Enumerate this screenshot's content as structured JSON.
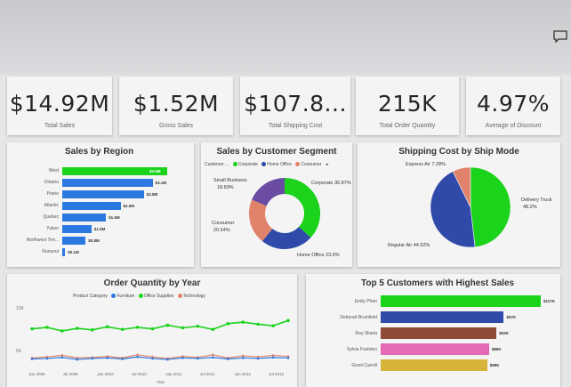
{
  "kpis": [
    {
      "value": "$14.92M",
      "label": "Total Sales"
    },
    {
      "value": "$1.52M",
      "label": "Gross Sales"
    },
    {
      "value": "$107.8...",
      "label": "Total Shipping Cost"
    },
    {
      "value": "215K",
      "label": "Total Order Quantity"
    },
    {
      "value": "4.97%",
      "label": "Average of Discount"
    }
  ],
  "colors": {
    "green": "#1ad31a",
    "blue": "#2a78e0",
    "navy": "#2f4aa8",
    "purple": "#6a4da3",
    "salmon": "#e0836a",
    "brown": "#8e4a34",
    "pink": "#e46ab6",
    "gold": "#d8b33a"
  },
  "sales_region": {
    "title": "Sales by Region",
    "chart_data": {
      "type": "bar",
      "categories": [
        "West",
        "Ontario",
        "Prarie",
        "Atlantic",
        "Quebec",
        "Yukon",
        "Northwest Terr...",
        "Nunavut"
      ],
      "values": [
        3.6,
        3.1,
        2.8,
        2.0,
        1.5,
        1.0,
        0.8,
        0.1
      ],
      "value_labels": [
        "$3.6M",
        "$3.1M",
        "$2.8M",
        "$2.0M",
        "$1.5M",
        "$1.0M",
        "$0.8M",
        "$0.1M"
      ]
    }
  },
  "segment": {
    "title": "Sales by Customer Segment",
    "legend_prefix": "Customer ...",
    "legend": [
      "Corporate",
      "Home Office",
      "Consumer"
    ],
    "chart_data": {
      "type": "pie",
      "categories": [
        "Corporate",
        "Home Office",
        "Consumer",
        "Small Business"
      ],
      "values": [
        36.87,
        23.9,
        20.54,
        18.69
      ]
    },
    "labels": {
      "corporate": "Corporate 36.87%",
      "home_office": "Home Office 23.9%",
      "consumer_name": "Consumer",
      "consumer_pct": "20.54%",
      "small_business_name": "Small Business",
      "small_business_pct": "18.69%"
    }
  },
  "ship_mode": {
    "title": "Shipping Cost by Ship Mode",
    "chart_data": {
      "type": "pie",
      "categories": [
        "Delivery Truck",
        "Regular Air",
        "Express Air"
      ],
      "values": [
        48.2,
        44.52,
        7.28
      ]
    },
    "labels": {
      "express": "Express Air 7.28%",
      "delivery_name": "Delivery Truck",
      "delivery_pct": "48.2%",
      "regular": "Regular Air 44.52%"
    }
  },
  "order_qty": {
    "title": "Order Quantity by Year",
    "legend_prefix": "Product Category",
    "legend": [
      "Furniture",
      "Office Supplies",
      "Technology"
    ],
    "y_ticks": [
      "10K",
      "5K"
    ],
    "x_label": "Year",
    "chart_data": {
      "type": "line",
      "x": [
        "Jan 2009",
        "Jul 2009",
        "Jan 2010",
        "Jul 2010",
        "Jan 2011",
        "Jul 2011",
        "Jan 2012",
        "Jul 2012"
      ],
      "x_tick_labels": [
        "Jan 2009",
        "Jul 2009",
        "Jan 2010",
        "Jul 2010",
        "Jan 2011",
        "Jul 2011",
        "Jan 2012",
        "Jul 2012"
      ],
      "series": [
        {
          "name": "Office Supplies",
          "values": [
            7.6,
            7.9,
            7.2,
            7.7,
            7.4,
            8.0,
            7.5,
            7.9,
            7.6,
            8.3,
            7.8,
            8.1,
            7.5,
            8.6,
            8.9,
            8.5,
            8.2,
            9.2
          ]
        },
        {
          "name": "Technology",
          "values": [
            2.0,
            2.2,
            2.5,
            2.0,
            2.1,
            2.3,
            2.0,
            2.6,
            2.2,
            1.9,
            2.3,
            2.1,
            2.6,
            2.0,
            2.4,
            2.2,
            2.5,
            2.3
          ]
        },
        {
          "name": "Furniture",
          "values": [
            1.8,
            1.9,
            2.1,
            1.7,
            1.9,
            2.0,
            1.8,
            2.2,
            1.9,
            1.7,
            2.0,
            1.9,
            2.1,
            1.8,
            2.0,
            1.9,
            2.1,
            2.0
          ]
        }
      ],
      "ylim": [
        0,
        12
      ]
    }
  },
  "top5": {
    "title": "Top 5 Customers with Highest Sales",
    "chart_data": {
      "type": "bar",
      "categories": [
        "Emily Phan",
        "Deborah Brumfield",
        "Roy Skaria",
        "Sylvia Foulston",
        "Grant Carroll"
      ],
      "values": [
        117,
        97,
        93,
        89,
        88
      ],
      "value_labels": [
        "$117K",
        "$97K",
        "$93K",
        "$89K",
        "$88K"
      ]
    }
  }
}
